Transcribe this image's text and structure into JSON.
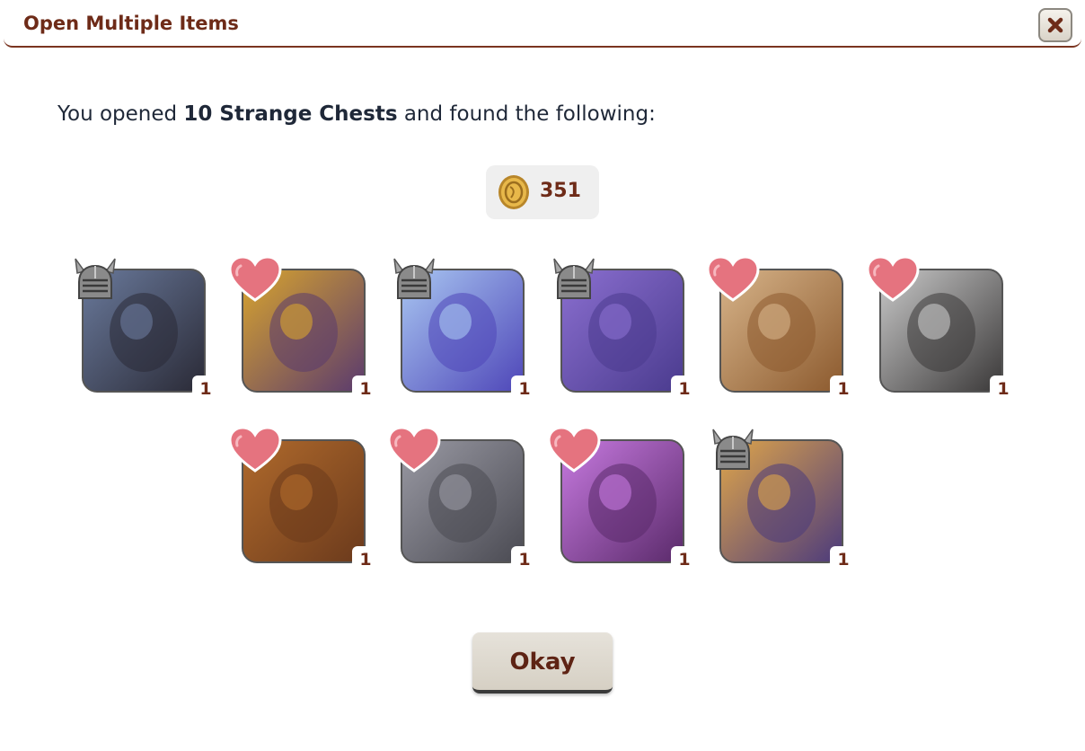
{
  "dialog": {
    "title": "Open Multiple Items",
    "close_icon": "close-icon",
    "message": {
      "prefix": "You opened ",
      "highlight": "10 Strange Chests",
      "suffix": " and found the following:"
    },
    "gold": {
      "icon": "gold-coin-icon",
      "amount": "351"
    },
    "items": [
      {
        "name": "dark-candle-spire",
        "badge": "helmet-icon",
        "qty": "1",
        "colors": [
          "#2a2a36",
          "#6a7a9c"
        ]
      },
      {
        "name": "golden-clock",
        "badge": "heart-icon",
        "qty": "1",
        "colors": [
          "#5a3a6e",
          "#d9a52e"
        ]
      },
      {
        "name": "blue-crystal-amulet",
        "badge": "helmet-icon",
        "qty": "1",
        "colors": [
          "#4e46b8",
          "#a9c7f2"
        ]
      },
      {
        "name": "purple-tome",
        "badge": "helmet-icon",
        "qty": "1",
        "colors": [
          "#4a3b8e",
          "#8b6fd0"
        ]
      },
      {
        "name": "swirl-parchment-dna",
        "badge": "heart-icon",
        "qty": "1",
        "colors": [
          "#8c5a2e",
          "#d7b48a"
        ]
      },
      {
        "name": "rolled-scroll",
        "badge": "heart-icon",
        "qty": "1",
        "colors": [
          "#3a3838",
          "#c9c9c9"
        ]
      },
      {
        "name": "bronze-dragon-armor",
        "badge": "heart-icon",
        "qty": "1",
        "colors": [
          "#6b3a1c",
          "#b06a2c"
        ]
      },
      {
        "name": "iron-maw",
        "badge": "heart-icon",
        "qty": "1",
        "colors": [
          "#4a4a52",
          "#9a9aa4"
        ]
      },
      {
        "name": "violet-eye-circlet",
        "badge": "heart-icon",
        "qty": "1",
        "colors": [
          "#5a2a6a",
          "#c77ae0"
        ]
      },
      {
        "name": "sunflower-crest-beast",
        "badge": "helmet-icon",
        "qty": "1",
        "colors": [
          "#4b3a7c",
          "#e0a64a"
        ]
      }
    ],
    "okay_label": "Okay"
  }
}
